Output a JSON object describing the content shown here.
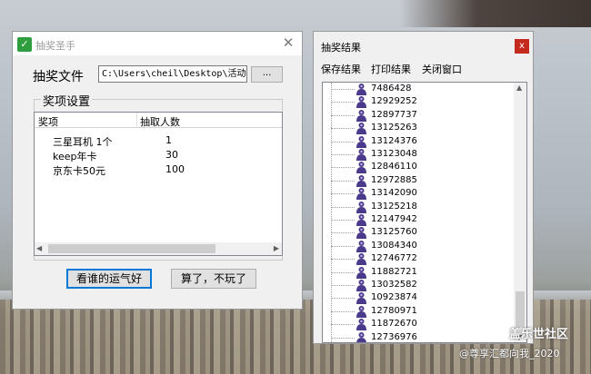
{
  "main_window": {
    "title": "抽奖圣手",
    "close_glyph": "✕",
    "file_label": "抽奖文件",
    "file_path": "C:\\Users\\cheil\\Desktop\\活动抽",
    "browse_label": "...",
    "group_title": "奖项设置",
    "columns": [
      "奖项",
      "抽取人数"
    ],
    "rows": [
      {
        "prize": "三星耳机 1个",
        "count": "1"
      },
      {
        "prize": "keep年卡",
        "count": "30"
      },
      {
        "prize": "京东卡50元",
        "count": "100"
      }
    ],
    "lucky_button": "看谁的运气好",
    "quit_button": "算了，不玩了"
  },
  "result_window": {
    "title": "抽奖结果",
    "close_glyph": "x",
    "menu": [
      "保存结果",
      "打印结果",
      "关闭窗口"
    ],
    "winners": [
      "7486428",
      "12929252",
      "12897737",
      "13125263",
      "13124376",
      "13123048",
      "12846110",
      "12972885",
      "13142090",
      "13125218",
      "12147942",
      "13125760",
      "13084340",
      "12746772",
      "11882721",
      "13032582",
      "10923874",
      "12780971",
      "11872670",
      "12736976"
    ]
  },
  "watermark": {
    "site": "盖乐世社区",
    "author": "@尊享汇都向我_2020"
  },
  "colors": {
    "accent_border": "#0078d7",
    "close_red": "#c42b1c",
    "app_icon_green": "#2f9e3e",
    "person_icon_purple": "#4b3a8c"
  }
}
